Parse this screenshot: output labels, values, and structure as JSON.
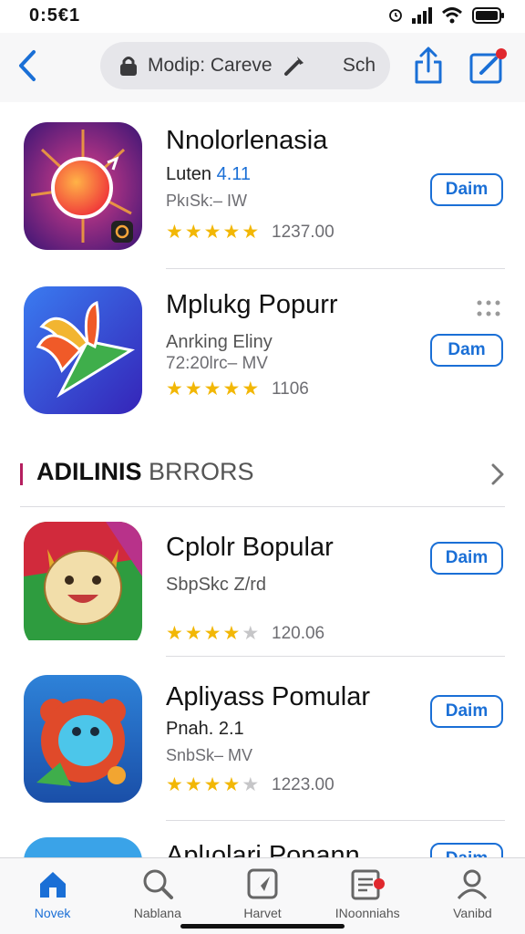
{
  "status": {
    "time": "0:5€1"
  },
  "nav": {
    "search_text": "Modip: Careve",
    "search_action": "Sch"
  },
  "apps": [
    {
      "name": "Nnolorlenasia",
      "sub1_main": "Luten ",
      "sub1_accent": "4.11",
      "sub2": "PkıSk:– IW",
      "stars": 4.5,
      "rating_count": "1237.00",
      "button": "Daim"
    },
    {
      "name": "Mplukg Popurr",
      "sub1_main": "Anrking Eliny",
      "sub1_accent": "",
      "sub2": "72:20lrc– MV",
      "stars": 5,
      "rating_count": "1106",
      "button": "Dam"
    },
    {
      "name": "Cplolr Bopular",
      "sub1_main": "SbpSkc Z/rd",
      "sub1_accent": "",
      "sub2": "",
      "stars": 3.5,
      "rating_count": "120.06",
      "button": "Daim"
    },
    {
      "name": "Apliyass Pomular",
      "sub1_main": "Pnah. 2.1",
      "sub1_accent": "",
      "sub2": "SnbSk– MV",
      "stars": 4,
      "rating_count": "1223.00",
      "button": "Daim"
    },
    {
      "name": "Aplıolari Ponann",
      "button": "Daim"
    }
  ],
  "section": {
    "title_strong": "ADILINIS",
    "title_light": " BRRORS"
  },
  "tabs": [
    {
      "label": "Novek",
      "icon": "home-icon",
      "active": true
    },
    {
      "label": "Nablana",
      "icon": "search-icon",
      "active": false
    },
    {
      "label": "Harvet",
      "icon": "compass-icon",
      "active": false
    },
    {
      "label": "INoonniahs",
      "icon": "notifications-icon",
      "active": false
    },
    {
      "label": "Vanibd",
      "icon": "account-icon",
      "active": false
    }
  ],
  "colors": {
    "accent": "#1a6fd6",
    "star": "#f2b705",
    "section_bar": "#b51f5f",
    "badge": "#e0282e"
  }
}
